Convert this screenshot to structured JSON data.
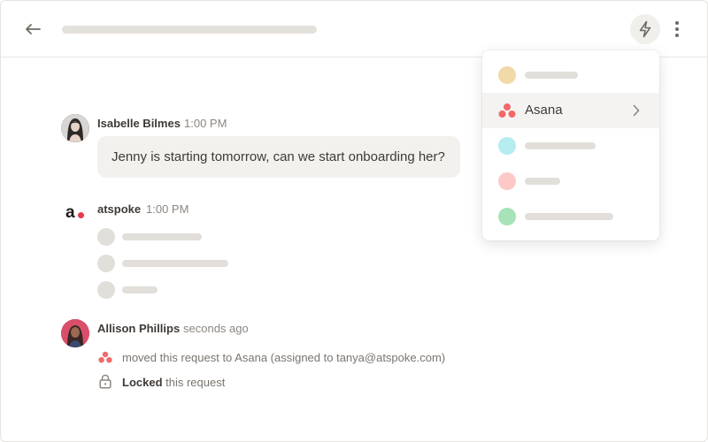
{
  "header": {
    "back_icon": "arrow-left-icon",
    "action_icon": "lightning-bolt-icon",
    "more_icon": "vertical-ellipsis-icon"
  },
  "messages": [
    {
      "author": "Isabelle Bilmes",
      "time": "1:00 PM",
      "text": "Jenny is starting tomorrow, can we start onboarding her?"
    },
    {
      "author": "atspoke",
      "time": "1:00 PM",
      "logo_text": "a"
    },
    {
      "author": "Allison Phillips",
      "time": "seconds ago"
    }
  ],
  "activity": [
    {
      "icon": "asana-icon",
      "text": "moved this request to Asana (assigned to tanya@atspoke.com)"
    },
    {
      "icon": "lock-icon",
      "bold": "Locked",
      "text": " this request"
    }
  ],
  "dropdown": {
    "items": [
      {
        "color": "#f2d9a8"
      },
      {
        "label": "Asana",
        "icon": "asana-icon",
        "submenu_icon": "chevron-right-icon"
      },
      {
        "color": "#b4ecef"
      },
      {
        "color": "#fcc8c8"
      },
      {
        "color": "#a6e3b8"
      }
    ]
  },
  "colors": {
    "asana": "#f06a6a",
    "atspoke_dot": "#e8384f"
  }
}
